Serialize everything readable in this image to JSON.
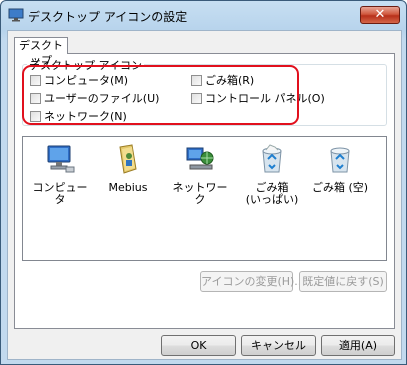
{
  "window": {
    "title": "デスクトップ アイコンの設定",
    "close_label": "✕"
  },
  "tabs": [
    {
      "label": "デスクトップ"
    }
  ],
  "group": {
    "title": "デスクトップ アイコン",
    "checkboxes": [
      {
        "label": "コンピュータ(M)",
        "checked": false
      },
      {
        "label": "ユーザーのファイル(U)",
        "checked": false
      },
      {
        "label": "ネットワーク(N)",
        "checked": false
      },
      {
        "label": "ごみ箱(R)",
        "checked": false
      },
      {
        "label": "コントロール パネル(O)",
        "checked": false
      }
    ]
  },
  "icons": [
    {
      "label": "コンピュータ",
      "icon": "computer-icon"
    },
    {
      "label": "Mebius",
      "icon": "user-folder-icon"
    },
    {
      "label": "ネットワーク",
      "icon": "network-icon"
    },
    {
      "label": "ごみ箱\n(いっぱい)",
      "icon": "recycle-bin-full-icon"
    },
    {
      "label": "ごみ箱 (空)",
      "icon": "recycle-bin-empty-icon"
    }
  ],
  "buttons": {
    "change_icon": "アイコンの変更(H)...",
    "restore_default": "既定値に戻す(S)",
    "ok": "OK",
    "cancel": "キャンセル",
    "apply": "適用(A)"
  },
  "colors": {
    "highlight": "#e1101d",
    "titlebar": "#b7d3ec"
  }
}
